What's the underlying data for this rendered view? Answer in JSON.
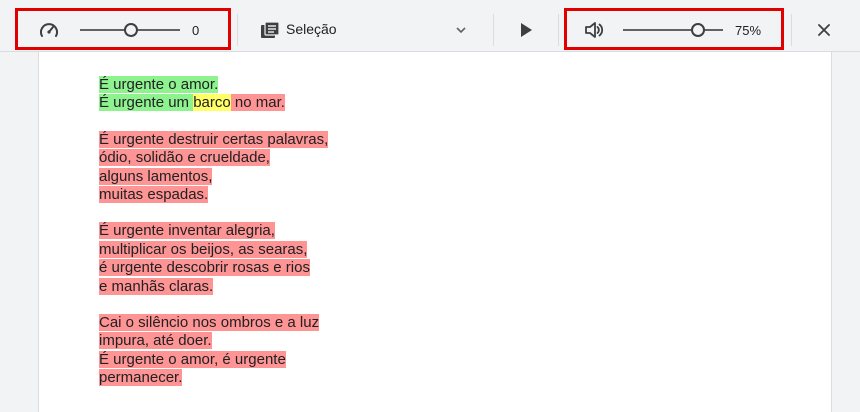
{
  "toolbar": {
    "speed": {
      "icon": "speedometer-icon",
      "value": "0",
      "slider_fraction": 0.5
    },
    "voice_select": {
      "icon": "document-icon",
      "selected": "Seleção",
      "arrow_icon": "chevron-down-icon"
    },
    "play": {
      "icon": "play-icon"
    },
    "volume": {
      "icon": "speaker-icon",
      "value": "75%",
      "slider_fraction": 0.75
    },
    "close": {
      "icon": "close-icon"
    }
  },
  "colors": {
    "highlight_read": "#ff9494",
    "highlight_current_line": "#8ef38e",
    "highlight_current_word": "#ffff66",
    "callout_border": "#e00000"
  },
  "poem": {
    "s1": {
      "l1": "É urgente o amor.",
      "l2_a": "É urgente um ",
      "l2_word": "barco",
      "l2_b": " no mar."
    },
    "s2": {
      "l1": "É urgente destruir certas palavras,",
      "l2": "ódio, solidão e crueldade,",
      "l3": "alguns lamentos,",
      "l4": "muitas espadas."
    },
    "s3": {
      "l1": "É urgente inventar alegria,",
      "l2": "multiplicar os beijos, as searas,",
      "l3": "é urgente descobrir rosas e rios",
      "l4": "e manhãs claras."
    },
    "s4": {
      "l1": "Cai o silêncio nos ombros e a luz",
      "l2": "impura, até doer.",
      "l3": "É urgente o amor, é urgente",
      "l4": "permanecer."
    }
  }
}
